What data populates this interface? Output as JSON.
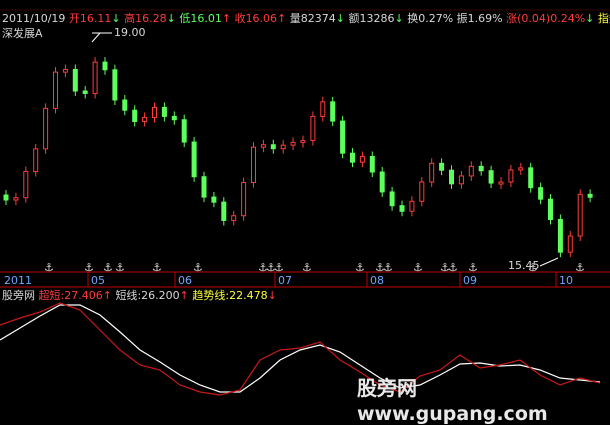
{
  "header": {
    "date": "2011/10/19",
    "open_label": "开",
    "open": "16.11",
    "high_label": "高",
    "high": "16.28",
    "low_label": "低",
    "low": "16.01",
    "close_label": "收",
    "close": "16.06",
    "vol_label": "量",
    "vol": "82374",
    "amt_label": "额",
    "amt": "13286",
    "turnover_label": "换",
    "turnover": "0.27%",
    "amp_label": "振",
    "amp": "1.69%",
    "chg_label": "涨",
    "chg": "(0.04)0.24%",
    "index_label": "指数"
  },
  "stock_name": "深发展A",
  "annotations": {
    "high_price": "19.00",
    "low_price": "15.45"
  },
  "time_axis": {
    "year": "2011",
    "months": [
      "05",
      "06",
      "07",
      "08",
      "09",
      "10"
    ]
  },
  "indicator": {
    "name": "股旁网",
    "l1_label": "超短",
    "l1_value": "27.406",
    "l2_label": "短线",
    "l2_value": "26.200",
    "l3_label": "趋势线",
    "l3_value": "22.478"
  },
  "watermark": {
    "cn": "股旁网",
    "url": "www.gupang.com"
  },
  "colors": {
    "up": "#ff3b3b",
    "down": "#5cff5c",
    "axis": "#c00000",
    "white": "#ffffff"
  }
}
